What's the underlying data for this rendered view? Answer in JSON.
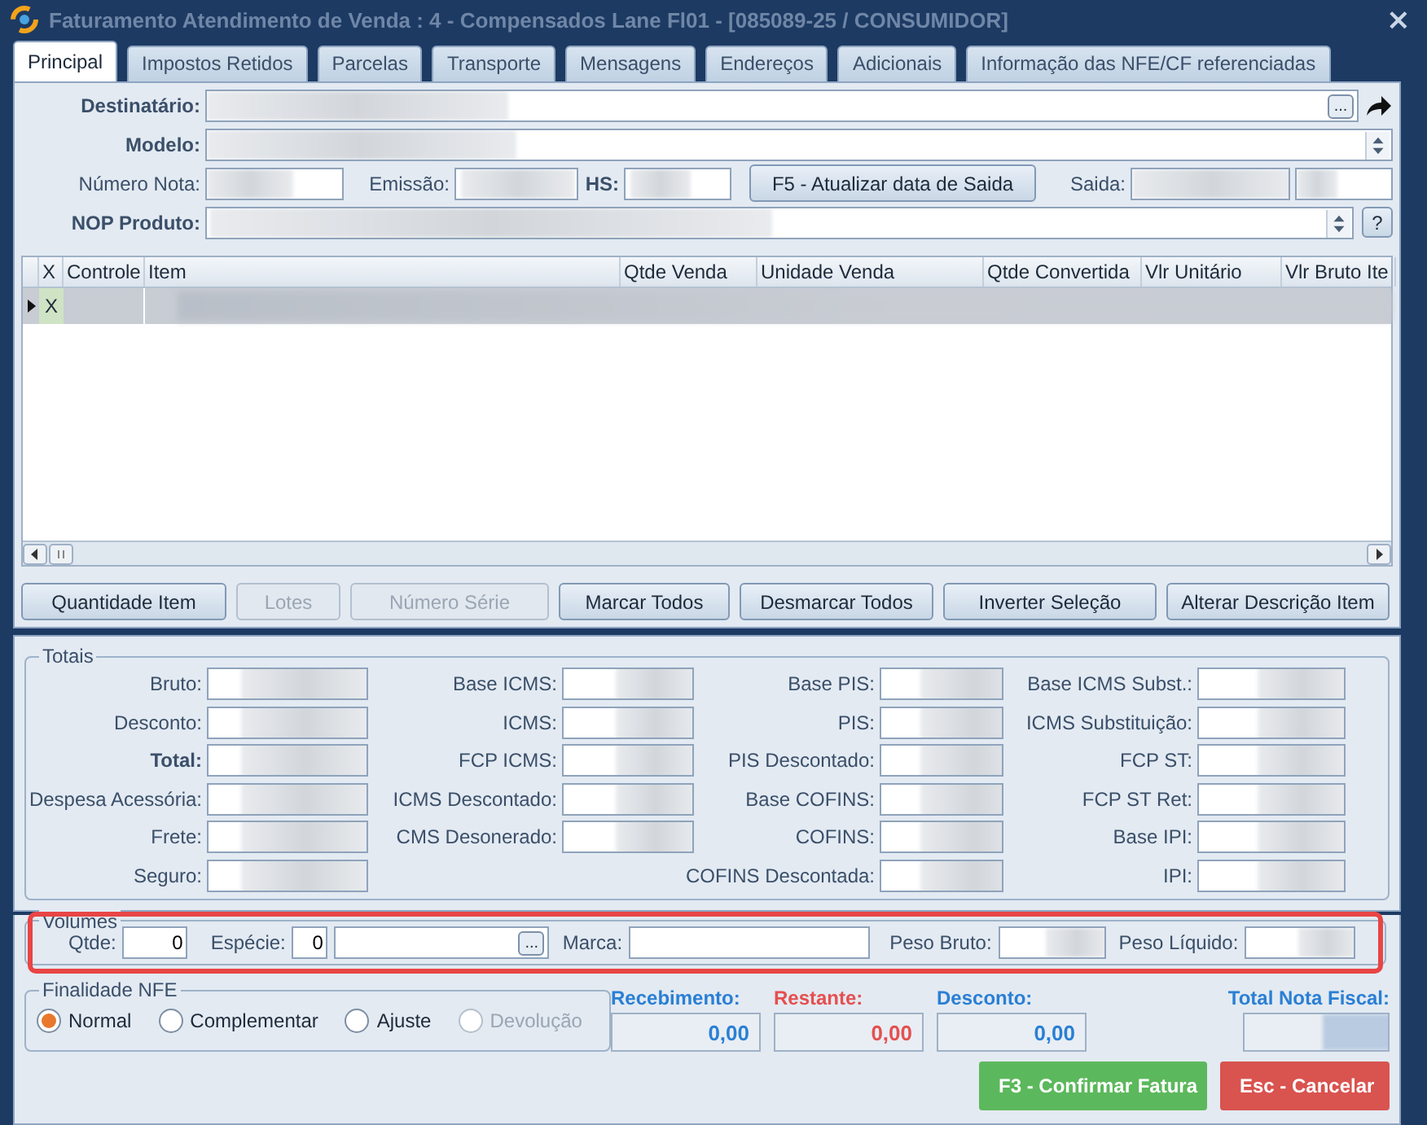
{
  "window": {
    "title": "Faturamento Atendimento de Venda : 4 - Compensados Lane Fl01 - [085089-25 / CONSUMIDOR]",
    "close": "×"
  },
  "tabs": [
    {
      "label": "Principal",
      "selected": true
    },
    {
      "label": "Impostos Retidos",
      "selected": false
    },
    {
      "label": "Parcelas",
      "selected": false
    },
    {
      "label": "Transporte",
      "selected": false
    },
    {
      "label": "Mensagens",
      "selected": false
    },
    {
      "label": "Endereços",
      "selected": false
    },
    {
      "label": "Adicionais",
      "selected": false
    },
    {
      "label": "Informação das NFE/CF referenciadas",
      "selected": false
    }
  ],
  "form": {
    "destinatario": {
      "label": "Destinatário:",
      "lookup_button": "..."
    },
    "modelo": {
      "label": "Modelo:"
    },
    "numero_nota": {
      "label": "Número Nota:"
    },
    "emissao": {
      "label": "Emissão:"
    },
    "hs": {
      "label": "HS:"
    },
    "update_button": "F5 - Atualizar data de Saida",
    "saida": {
      "label": "Saida:"
    },
    "nop_produto": {
      "label": "NOP Produto:",
      "help_button": "?"
    }
  },
  "grid": {
    "columns": [
      "X",
      "Controle",
      "Item",
      "Qtde Venda",
      "Unidade Venda",
      "Qtde Convertida",
      "Vlr Unitário",
      "Vlr Bruto Ite"
    ],
    "rows": [
      {
        "mark": "X",
        "selected": true
      }
    ]
  },
  "item_buttons": [
    {
      "label": "Quantidade Item",
      "disabled": false
    },
    {
      "label": "Lotes",
      "disabled": true
    },
    {
      "label": "Número Série",
      "disabled": true
    },
    {
      "label": "Marcar Todos",
      "disabled": false
    },
    {
      "label": "Desmarcar Todos",
      "disabled": false
    },
    {
      "label": "Inverter Seleção",
      "disabled": false
    },
    {
      "label": "Alterar Descrição Item",
      "disabled": false
    }
  ],
  "totals": {
    "title": "Totais",
    "columns": [
      [
        {
          "label": "Bruto:",
          "emphasis": false
        },
        {
          "label": "Desconto:",
          "emphasis": false
        },
        {
          "label": "Total:",
          "emphasis": true
        },
        {
          "label": "Despesa Acessória:",
          "emphasis": false
        },
        {
          "label": "Frete:",
          "emphasis": false
        },
        {
          "label": "Seguro:",
          "emphasis": false
        }
      ],
      [
        {
          "label": "Base ICMS:",
          "emphasis": false
        },
        {
          "label": "ICMS:",
          "emphasis": false
        },
        {
          "label": "FCP ICMS:",
          "emphasis": false
        },
        {
          "label": "ICMS Descontado:",
          "emphasis": false
        },
        {
          "label": "CMS Desonerado:",
          "emphasis": false
        }
      ],
      [
        {
          "label": "Base PIS:",
          "emphasis": false
        },
        {
          "label": "PIS:",
          "emphasis": false
        },
        {
          "label": "PIS Descontado:",
          "emphasis": false
        },
        {
          "label": "Base COFINS:",
          "emphasis": false
        },
        {
          "label": "COFINS:",
          "emphasis": false
        },
        {
          "label": "COFINS Descontada:",
          "emphasis": false
        }
      ],
      [
        {
          "label": "Base ICMS Subst.:",
          "emphasis": false
        },
        {
          "label": "ICMS Substituição:",
          "emphasis": false
        },
        {
          "label": "FCP ST:",
          "emphasis": false
        },
        {
          "label": "FCP ST Ret:",
          "emphasis": false
        },
        {
          "label": "Base IPI:",
          "emphasis": false
        },
        {
          "label": "IPI:",
          "emphasis": false
        }
      ]
    ]
  },
  "volumes": {
    "title": "Volumes",
    "highlighted": true,
    "qtde": {
      "label": "Qtde:",
      "value": "0"
    },
    "especie": {
      "label": "Espécie:",
      "value": "0",
      "lookup_button": "..."
    },
    "marca": {
      "label": "Marca:"
    },
    "peso_bruto": {
      "label": "Peso Bruto:"
    },
    "peso_liquido": {
      "label": "Peso Líquido:"
    }
  },
  "finalidade": {
    "title": "Finalidade NFE",
    "options": [
      {
        "label": "Normal",
        "selected": true,
        "disabled": false
      },
      {
        "label": "Complementar",
        "selected": false,
        "disabled": false
      },
      {
        "label": "Ajuste",
        "selected": false,
        "disabled": false
      },
      {
        "label": "Devolução",
        "selected": false,
        "disabled": true
      }
    ]
  },
  "summary": [
    {
      "label": "Recebimento:",
      "value": "0,00",
      "color": "#2a7fd4"
    },
    {
      "label": "Restante:",
      "value": "0,00",
      "color": "#e5504f"
    },
    {
      "label": "Desconto:",
      "value": "0,00",
      "color": "#2a7fd4"
    },
    {
      "label": "Total Nota Fiscal:",
      "color": "#2a7fd4"
    }
  ],
  "actions": [
    {
      "label": "F3 - Confirmar Fatura",
      "kind": "confirm"
    },
    {
      "label": "Esc - Cancelar",
      "kind": "cancel"
    }
  ]
}
